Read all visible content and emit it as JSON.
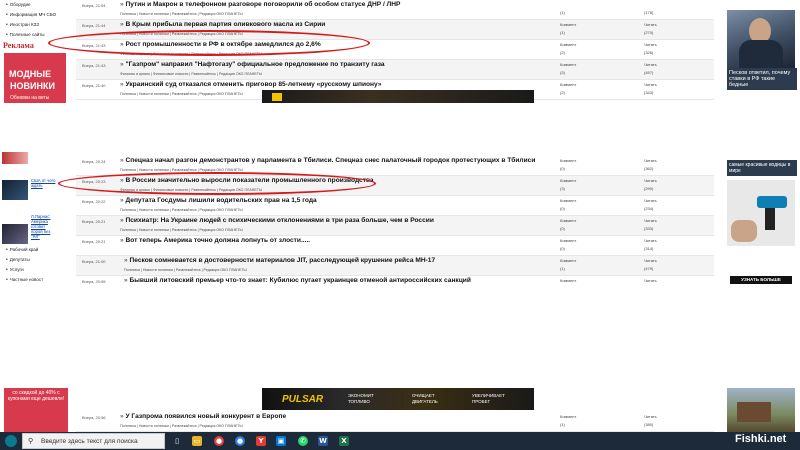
{
  "sidebar_top": {
    "items": [
      "Оборудие",
      "Информация МЧ СБО",
      "Иностран КЗЗ",
      "Полезные сайты"
    ],
    "ad_label": "Реклама",
    "banner_line1": "МОДНЫЕ",
    "banner_line2": "НОВИНКИ",
    "banner_line3": "Обновки на веты"
  },
  "list_top": [
    {
      "time": "Вчера, 21:54",
      "title": "Путин и Макрон в телефонном разговоре поговорили об особом статусе ДНР / ЛНР",
      "cats": "Политика | Новости политики | Развлекайтесь | Редакция ОКО ПЛАНЕТЫ",
      "clabel": "",
      "cval": "(1)",
      "rlabel": "",
      "rval": "(178)"
    },
    {
      "time": "Вчера, 21:44",
      "title": "В Крым прибыла первая партия оливкового масла из Сирии",
      "cats": "Политика | Новости политики | Развлекайтесь | Редакция ОКО ПЛАНЕТЫ",
      "clabel": "Коммент",
      "cval": "(1)",
      "rlabel": "Читать",
      "rval": "(270)"
    },
    {
      "time": "Вчера, 21:43",
      "title": "Рост промышленности в РФ в октябре замедлился до 2,6%",
      "cats": "Финансы и кризис | Финансовые новости | Развлекайтесь | Редакция ОКО ПЛАНЕТЫ",
      "clabel": "Коммент",
      "cval": "(2)",
      "rlabel": "Читать",
      "rval": "(326)"
    },
    {
      "time": "Вчера, 21:43",
      "title": "\"Газпром\" направил \"Нафтогазу\" официальное предложение по транзиту газа",
      "cats": "Финансы и кризис | Финансовые новости | Развлекайтесь | Редакция ОКО ПЛАНЕТЫ",
      "clabel": "Коммент",
      "cval": "(3)",
      "rlabel": "Читать",
      "rval": "(457)"
    },
    {
      "time": "Вчера, 21:40",
      "title": "Украинский суд отказался отменить приговор 85-летнему «русскому шпиону»",
      "cats": "Политика | Новости политики | Развлекайтесь | Редакция ОКО ПЛАНЕТЫ",
      "clabel": "Коммент",
      "cval": "(2)",
      "rlabel": "Читать",
      "rval": "(343)"
    }
  ],
  "right_top": {
    "caption": "Песков ответил, почему ставки в РФ такие бедные"
  },
  "sidebar_mid": {
    "link1": "США от чего ждать",
    "link2": "Л.Парнас: Америка готовит порой без \"ЯЛ\"",
    "items": [
      "Рабочий край",
      "Депутаты",
      "Услуги",
      "Частные новост"
    ]
  },
  "list_mid": [
    {
      "time": "Вчера, 20:24",
      "title": "Спецназ начал разгон демонстрантов у парламента в Тбилиси. Спецназ снес палаточный городок протестующих в Тбилиси",
      "cats": "Политика | Новости политики | Развлекайтесь | Редакция ОКО ПЛАНЕТЫ",
      "clabel": "Коммент",
      "cval": "(0)",
      "rlabel": "Читать",
      "rval": "(362)",
      "indent": false
    },
    {
      "time": "Вчера, 20:23",
      "title": "В России значительно выросли показатели промышленного производства",
      "cats": "Финансы и кризис | Финансовые новости | Развлекайтесь | Редакция ОКО ПЛАНЕТЫ",
      "clabel": "Коммент",
      "cval": "(3)",
      "rlabel": "Читать",
      "rval": "(290)",
      "indent": false
    },
    {
      "time": "Вчера, 20:22",
      "title": "Депутата Госдумы лишили водительских прав на 1,5 года",
      "cats": "Политика | Новости политики | Развлекайтесь | Редакция ОКО ПЛАНЕТЫ",
      "clabel": "Коммент",
      "cval": "(0)",
      "rlabel": "Читать",
      "rval": "(234)",
      "indent": false
    },
    {
      "time": "Вчера, 20:21",
      "title": "Психиатр: На Украине людей с психическими отклонениями в три раза больше, чем в России",
      "cats": "Политика | Новости политики | Развлекайтесь | Редакция ОКО ПЛАНЕТЫ",
      "clabel": "Коммент",
      "cval": "(0)",
      "rlabel": "Читать",
      "rval": "(333)",
      "indent": false
    },
    {
      "time": "Вчера, 20:21",
      "title": "Вот теперь Америка точно должна лопнуть от злости.....",
      "cats": "",
      "clabel": "Коммент",
      "cval": "(0)",
      "rlabel": "Читать",
      "rval": "(314)",
      "indent": false
    },
    {
      "time": "Вчера, 21:00",
      "title": "Песков сомневается в достоверности материалов JIT, расследующей крушение рейса МН-17",
      "cats": "Политика | Новости политики | Развлекайтесь | Редакция ОКО ПЛАНЕТЫ",
      "clabel": "Коммент",
      "cval": "(1)",
      "rlabel": "Читать",
      "rval": "(479)",
      "indent": true
    },
    {
      "time": "Вчера, 20:55",
      "title": "Бывший литовский премьер что-то знает: Кубилюс пугает украинцев отменой антироссийских санкций",
      "cats": "Политика | Новости политики | Развлекайтесь | Редакция ОКО ПЛАНЕТЫ",
      "clabel": "Коммент",
      "cval": "(0)",
      "rlabel": "Читать",
      "rval": "(222)",
      "indent": true
    }
  ],
  "right_mid": {
    "caption": "самые красивые водицы в мире",
    "button": "УЗНАТЬ БОЛЬШЕ"
  },
  "ad_bottom": {
    "left_text": "со скидкой до 40% с купонами еще дешевле!",
    "brand": "PULSAR",
    "s1": "ЭКОНОМИТ ТОПЛИВО",
    "s2": "ОЧИЩАЕТ ДВИГАТЕЛЬ",
    "s3": "УВЕЛИЧИВАЕТ ПРОБЕГ"
  },
  "list_bottom": [
    {
      "time": "Вчера, 20:56",
      "title": "У Газпрома появился новый конкурент в Европе",
      "cats": "Политика | Новости политики | Развлекайтесь | Редакция ОКО ПЛАНЕТЫ",
      "clabel": "Коммент",
      "cval": "(1)",
      "rlabel": "Читать",
      "rval": "(380)"
    }
  ],
  "taskbar": {
    "search_placeholder": "Введите здесь текст для поиска",
    "watermark": "Fishki.net"
  },
  "colors": {
    "highlight": "#d41a1a",
    "taskbar": "#1c2a3a",
    "ad_red": "#c0272d"
  }
}
